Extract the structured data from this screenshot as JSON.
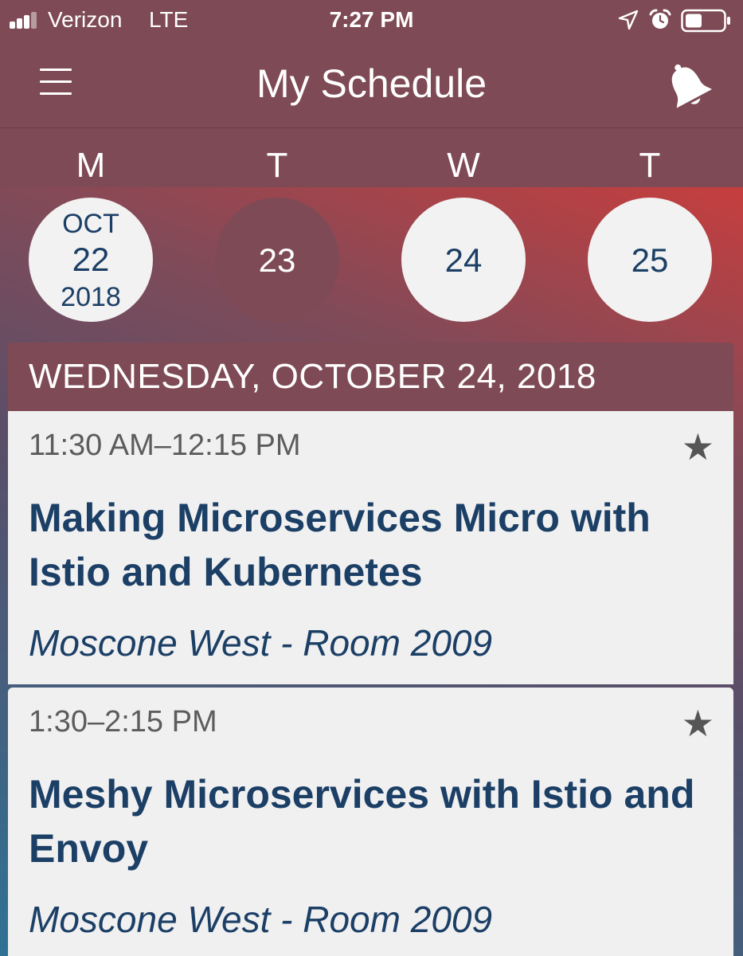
{
  "status_bar": {
    "carrier": "Verizon",
    "network": "LTE",
    "time": "7:27 PM",
    "icons": [
      "signal-icon",
      "location-arrow-icon",
      "alarm-clock-icon",
      "battery-icon"
    ]
  },
  "header": {
    "title": "My Schedule",
    "left_icon": "hamburger-menu-icon",
    "right_icon": "bell-icon"
  },
  "calendar": {
    "weekdays": [
      "M",
      "T",
      "W",
      "T"
    ],
    "days": [
      {
        "month": "OCT",
        "day": "22",
        "year": "2018",
        "state": "today"
      },
      {
        "day": "23",
        "state": "selected"
      },
      {
        "day": "24",
        "state": "default"
      },
      {
        "day": "25",
        "state": "default"
      }
    ]
  },
  "schedule": {
    "date_heading": "WEDNESDAY, OCTOBER 24, 2018",
    "sessions": [
      {
        "time": "11:30 AM–12:15 PM",
        "title": "Making Microservices Micro with Istio and Kubernetes",
        "room": "Moscone West - Room 2009",
        "starred_icon": "star-icon"
      },
      {
        "time": "1:30–2:15 PM",
        "title": "Meshy Microservices with Istio and Envoy",
        "room": "Moscone West - Room 2009",
        "starred_icon": "star-icon"
      }
    ]
  },
  "colors": {
    "primary": "#7e4a55",
    "text_blue": "#1c3f66",
    "card_bg": "#f0f0f1",
    "gradient_red": "#c63e3e",
    "gradient_blue": "#2f7294"
  }
}
